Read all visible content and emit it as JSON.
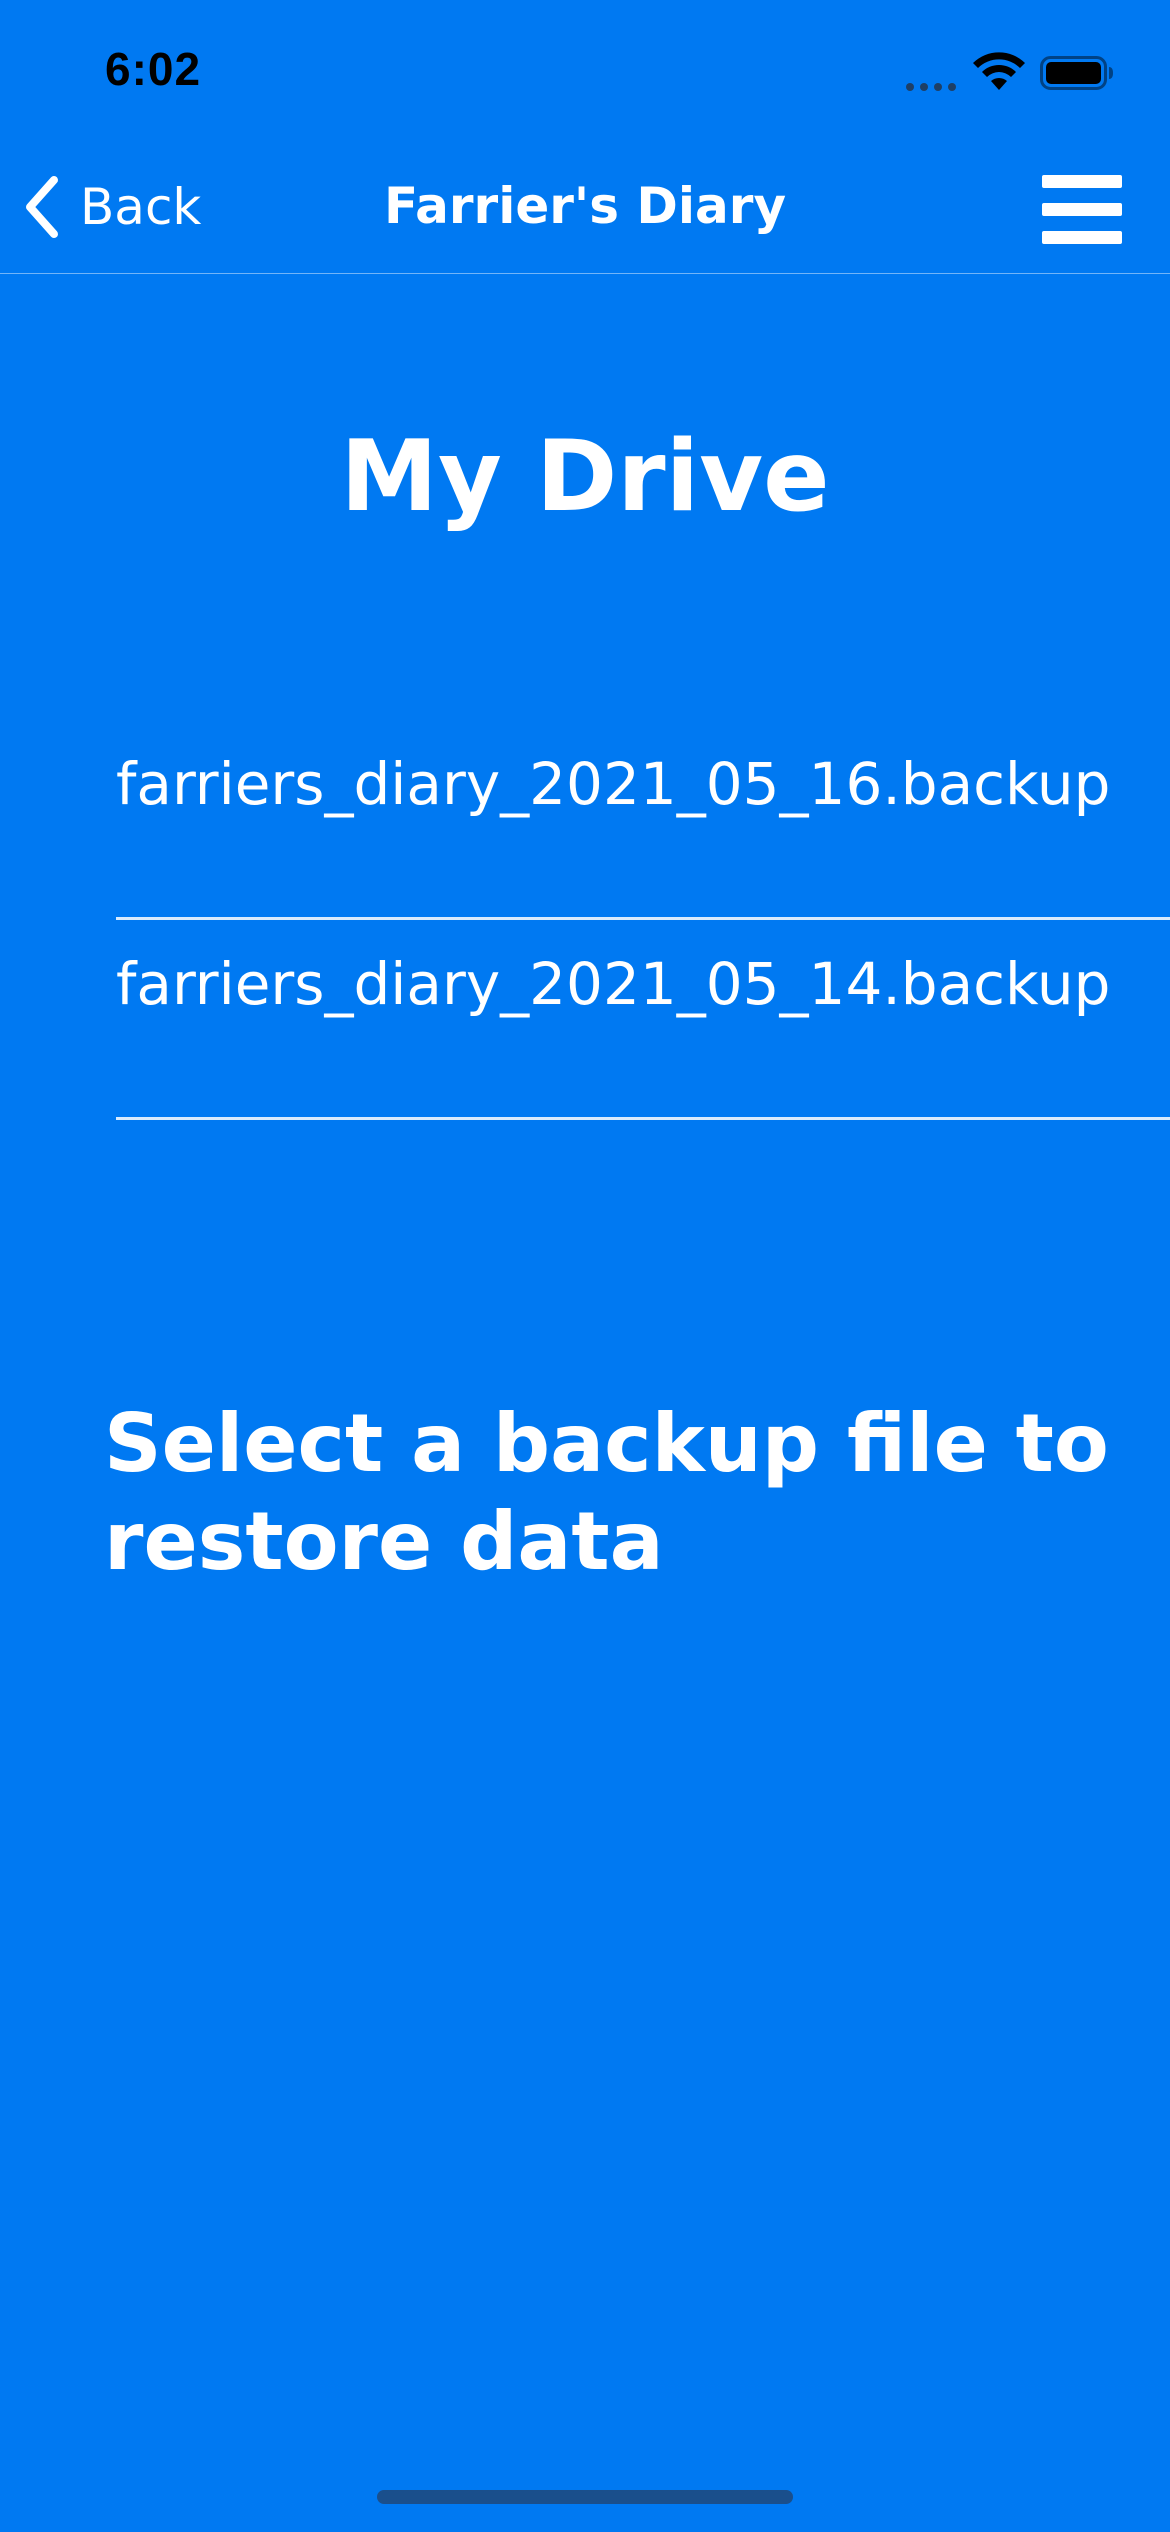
{
  "status_bar": {
    "time": "6:02"
  },
  "nav": {
    "back_label": "Back",
    "title": "Farrier's Diary"
  },
  "main": {
    "heading": "My Drive",
    "files": [
      "farriers_diary_2021_05_16.backup",
      "farriers_diary_2021_05_14.backup"
    ],
    "instruction": "Select a backup file to restore data"
  },
  "colors": {
    "background": "#0079f2",
    "text": "#ffffff",
    "status_text": "#000000"
  }
}
